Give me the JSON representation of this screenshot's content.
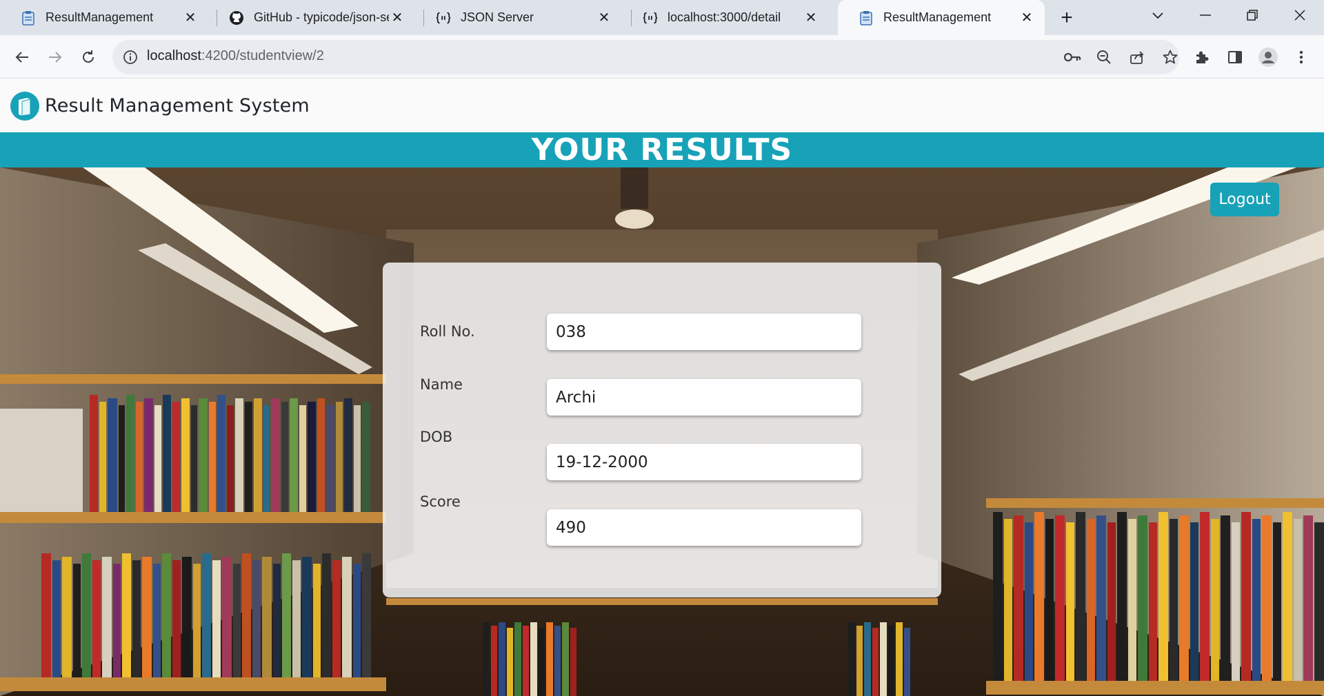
{
  "browser": {
    "tabs": [
      {
        "title": "ResultManagement",
        "icon": "clipboard-icon",
        "active": false
      },
      {
        "title": "GitHub - typicode/json-se",
        "icon": "github-icon",
        "active": false
      },
      {
        "title": "JSON Server",
        "icon": "json-server-icon",
        "active": false
      },
      {
        "title": "localhost:3000/detail",
        "icon": "json-server-icon",
        "active": false
      },
      {
        "title": "ResultManagement",
        "icon": "clipboard-icon",
        "active": true
      }
    ],
    "url_host": "localhost",
    "url_rest": ":4200/studentview/2"
  },
  "app": {
    "brand_title": "Result Management System",
    "results_heading": "YOUR RESULTS",
    "logout_label": "Logout"
  },
  "student": {
    "roll_label": "Roll No.",
    "roll_value": "038",
    "name_label": "Name",
    "name_value": "Archi",
    "dob_label": "DOB",
    "dob_value": "19-12-2000",
    "score_label": "Score",
    "score_value": "490"
  },
  "colors": {
    "accent": "#17a2b8",
    "tabstrip": "#dee3ea",
    "toolbar": "#f7f8fa"
  }
}
